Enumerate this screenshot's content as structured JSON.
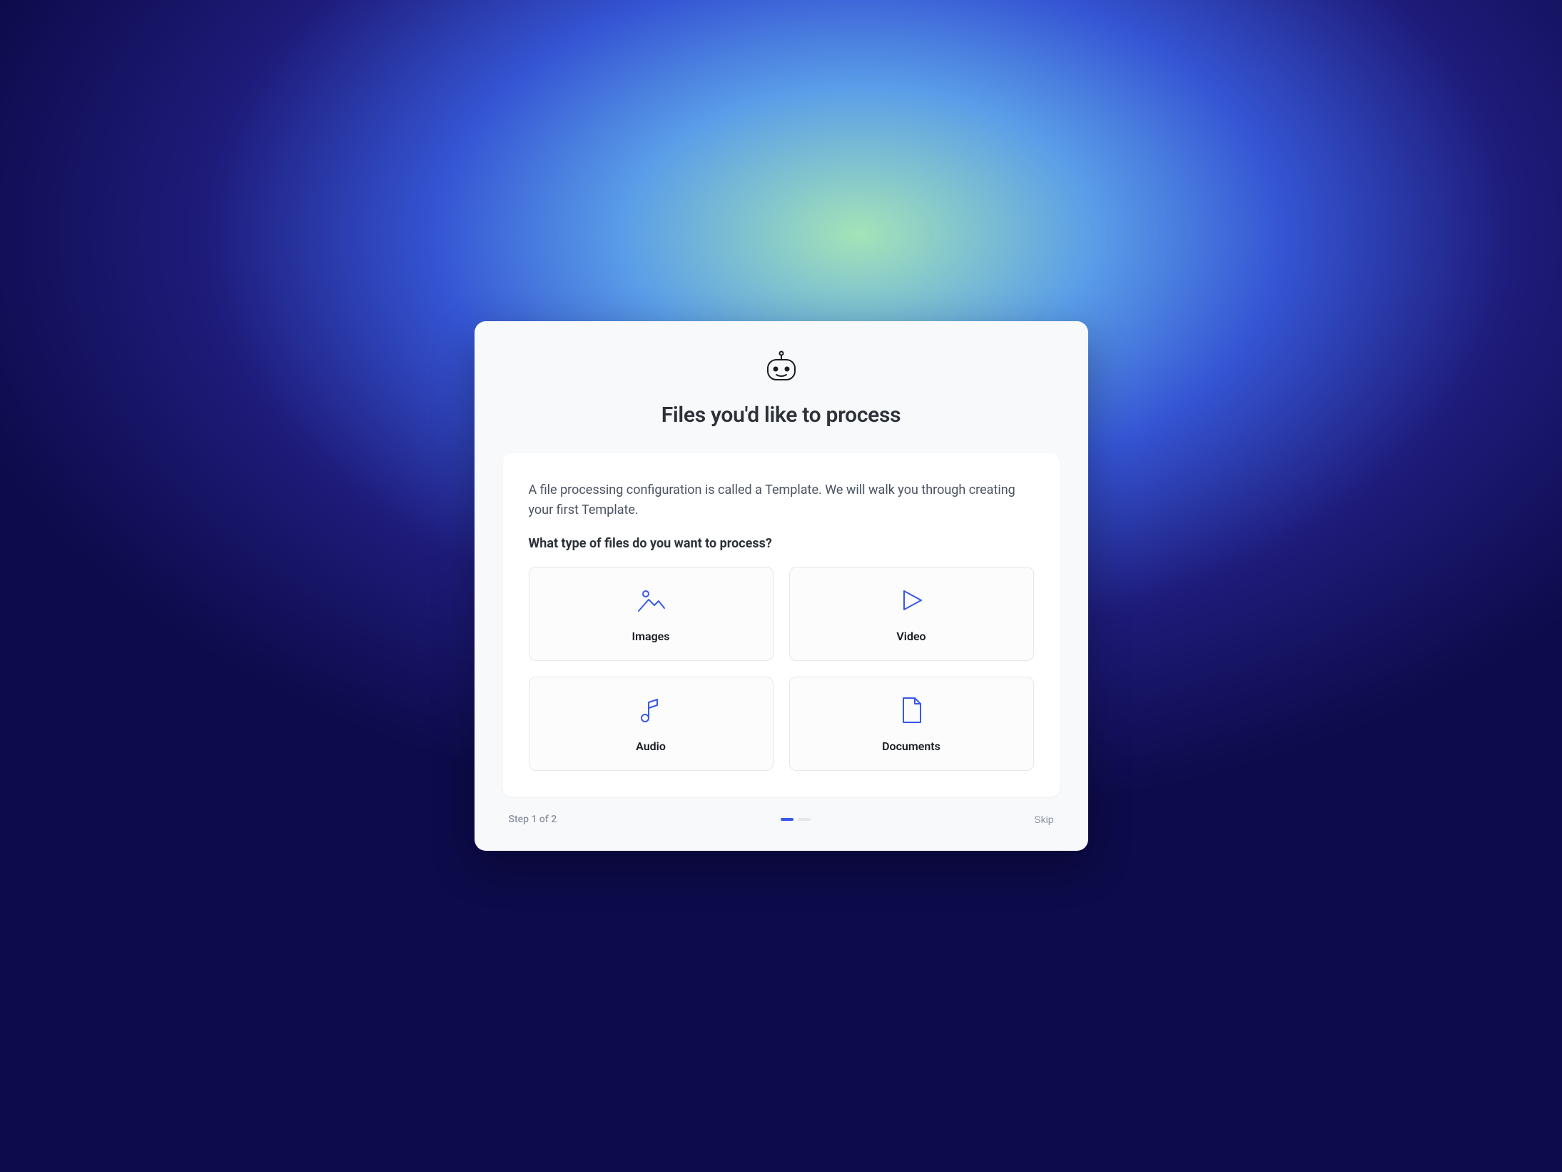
{
  "header": {
    "title": "Files you'd like to process"
  },
  "card": {
    "intro": "A file processing configuration is called a Template. We will walk you through creating your first Template.",
    "question": "What type of files do you want to process?",
    "tiles": [
      {
        "label": "Images",
        "icon": "image-icon"
      },
      {
        "label": "Video",
        "icon": "play-icon"
      },
      {
        "label": "Audio",
        "icon": "music-note-icon"
      },
      {
        "label": "Documents",
        "icon": "document-icon"
      }
    ]
  },
  "footer": {
    "step_label": "Step 1 of 2",
    "skip_label": "Skip",
    "current_step": 1,
    "total_steps": 2
  },
  "colors": {
    "accent": "#3858e9"
  }
}
